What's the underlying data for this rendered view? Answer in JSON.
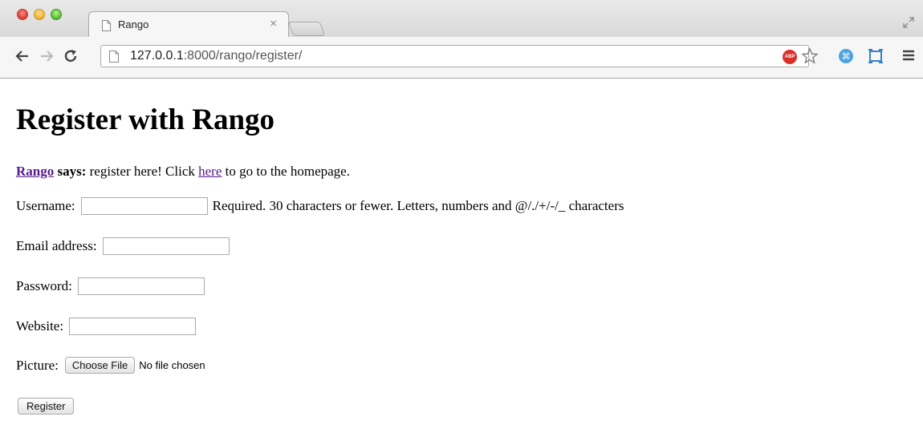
{
  "browser": {
    "tab_title": "Rango",
    "tab_close": "×",
    "url_host": "127.0.0.1",
    "url_rest": ":8000/rango/register/"
  },
  "icons": {
    "back": "arrow-left-icon",
    "forward": "arrow-right-icon",
    "reload": "reload-icon",
    "page": "page-icon",
    "adblock": "adblock-icon",
    "adblock_text": "ABP",
    "bookmark": "star-icon",
    "extension": "extension-icon",
    "cast": "cast-icon",
    "menu": "menu-icon"
  },
  "page": {
    "heading": "Register with Rango",
    "says": {
      "brand_link": "Rango",
      "says_label": "says:",
      "text_before": " register here! Click ",
      "here_link": "here",
      "text_after": " to go to the homepage."
    },
    "form": {
      "username_label": "Username:",
      "username_value": "",
      "username_help": "Required. 30 characters or fewer. Letters, numbers and @/./+/-/_ characters",
      "email_label": "Email address:",
      "email_value": "",
      "password_label": "Password:",
      "password_value": "",
      "website_label": "Website:",
      "website_value": "",
      "picture_label": "Picture:",
      "choose_file_label": "Choose File",
      "no_file_text": "No file chosen",
      "submit_label": "Register"
    }
  }
}
